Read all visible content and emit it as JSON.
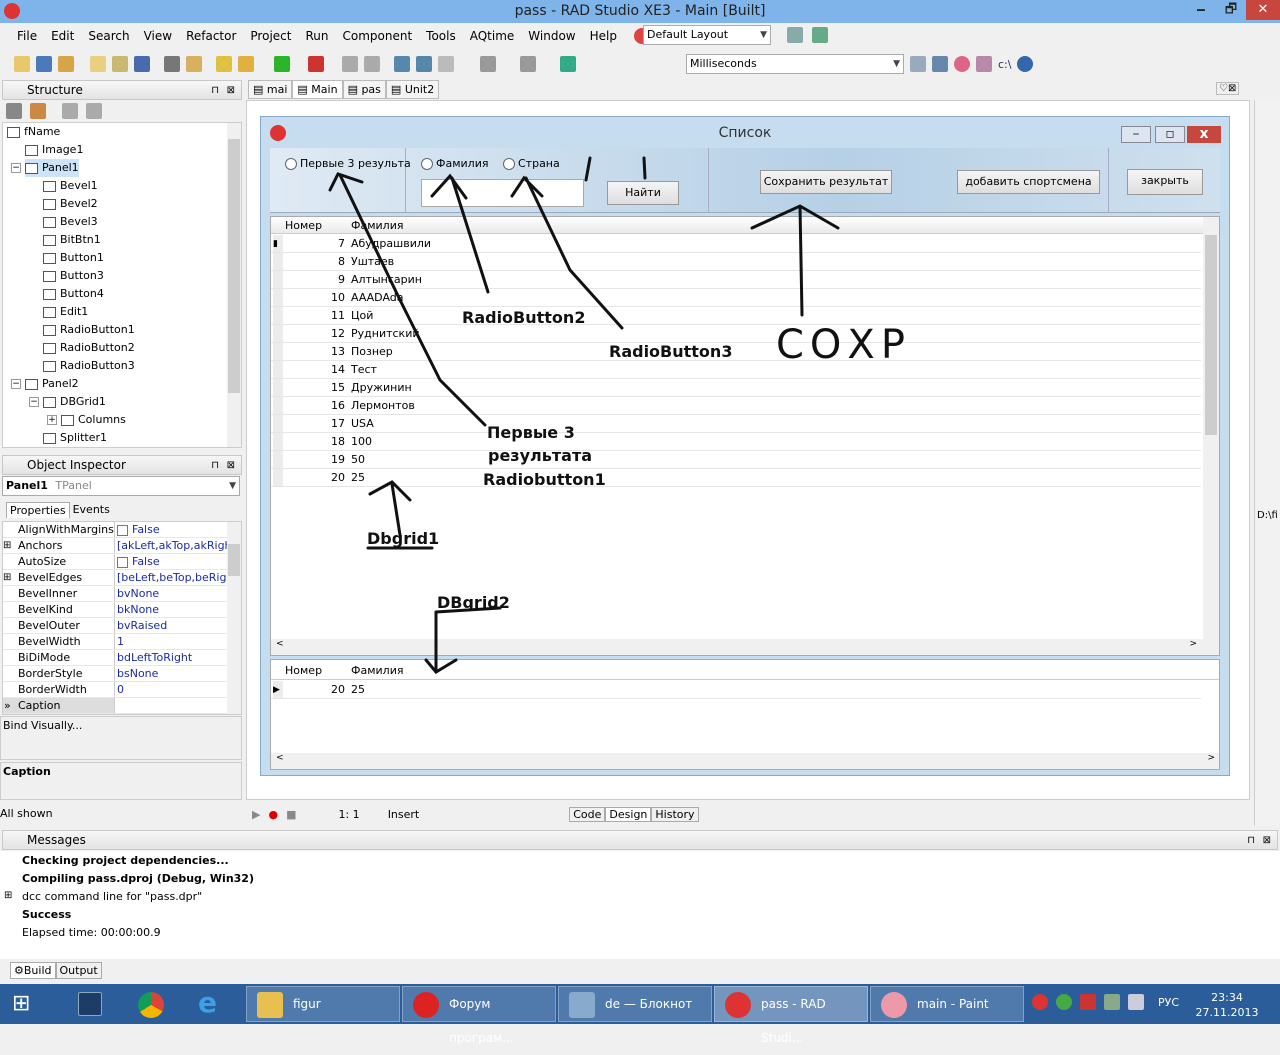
{
  "window": {
    "title": "pass - RAD Studio XE3 - Main [Built]",
    "minimize": "🗕",
    "maximize": "🗗",
    "close": "✕"
  },
  "menu": [
    "File",
    "Edit",
    "Search",
    "View",
    "Refactor",
    "Project",
    "Run",
    "Component",
    "Tools",
    "AQtime",
    "Window",
    "Help"
  ],
  "toolbar": {
    "layout_combo": "Default Layout",
    "profiler_combo": "Milliseconds",
    "path_button": "c:\\"
  },
  "structure": {
    "title": "Structure",
    "tree": [
      {
        "label": "fName",
        "level": 0,
        "expander": "−"
      },
      {
        "label": "Image1",
        "level": 1
      },
      {
        "label": "Panel1",
        "level": 1,
        "expander": "−",
        "selected": true
      },
      {
        "label": "Bevel1",
        "level": 2
      },
      {
        "label": "Bevel2",
        "level": 2
      },
      {
        "label": "Bevel3",
        "level": 2
      },
      {
        "label": "BitBtn1",
        "level": 2
      },
      {
        "label": "Button1",
        "level": 2
      },
      {
        "label": "Button3",
        "level": 2
      },
      {
        "label": "Button4",
        "level": 2
      },
      {
        "label": "Edit1",
        "level": 2
      },
      {
        "label": "RadioButton1",
        "level": 2
      },
      {
        "label": "RadioButton2",
        "level": 2
      },
      {
        "label": "RadioButton3",
        "level": 2
      },
      {
        "label": "Panel2",
        "level": 1,
        "expander": "−"
      },
      {
        "label": "DBGrid1",
        "level": 2,
        "expander": "−"
      },
      {
        "label": "Columns",
        "level": 3,
        "expander": "+"
      },
      {
        "label": "Splitter1",
        "level": 2
      }
    ]
  },
  "inspector": {
    "title": "Object Inspector",
    "object_name": "Panel1",
    "object_type": "TPanel",
    "tabs": [
      "Properties",
      "Events"
    ],
    "properties": [
      {
        "key": "AlignWithMargins",
        "value": "False",
        "checkbox": true
      },
      {
        "key": "Anchors",
        "value": "[akLeft,akTop,akRight]",
        "expander": "+"
      },
      {
        "key": "AutoSize",
        "value": "False",
        "checkbox": true
      },
      {
        "key": "BevelEdges",
        "value": "[beLeft,beTop,beRight",
        "expander": "+"
      },
      {
        "key": "BevelInner",
        "value": "bvNone"
      },
      {
        "key": "BevelKind",
        "value": "bkNone"
      },
      {
        "key": "BevelOuter",
        "value": "bvRaised"
      },
      {
        "key": "BevelWidth",
        "value": "1"
      },
      {
        "key": "BiDiMode",
        "value": "bdLeftToRight"
      },
      {
        "key": "BorderStyle",
        "value": "bsNone"
      },
      {
        "key": "BorderWidth",
        "value": "0"
      },
      {
        "key": "Caption",
        "value": "",
        "selected": true
      }
    ],
    "bind_visually": "Bind Visually...",
    "help_title": "Caption",
    "status": "All shown"
  },
  "editor": {
    "tabs": [
      "mai",
      "Main",
      "pas",
      "Unit2"
    ],
    "active_tab": "Main",
    "status": {
      "position": "1:   1",
      "mode": "Insert"
    },
    "bottom_tabs": [
      "Code",
      "Design",
      "History"
    ],
    "active_bottom_tab": "Design"
  },
  "form": {
    "title": "Список",
    "radio1": "Первые 3 результа",
    "radio2": "Фамилия",
    "radio3": "Страна",
    "edit_value": "",
    "find_button": "Найти",
    "save_button": "Сохранить результат",
    "add_button": "добавить спортсмена",
    "close_button": "закрыть",
    "grid1": {
      "columns": [
        "Номер",
        "Фамилия"
      ],
      "rows": [
        {
          "num": "7",
          "name": "Абудрашвили"
        },
        {
          "num": "8",
          "name": "Уштаев"
        },
        {
          "num": "9",
          "name": "Алтынсарин"
        },
        {
          "num": "10",
          "name": "AAADAda"
        },
        {
          "num": "11",
          "name": "Цой"
        },
        {
          "num": "12",
          "name": "Руднитский"
        },
        {
          "num": "13",
          "name": "Познер"
        },
        {
          "num": "14",
          "name": "Тест"
        },
        {
          "num": "15",
          "name": "Дружинин"
        },
        {
          "num": "16",
          "name": "Лермонтов"
        },
        {
          "num": "17",
          "name": "USA"
        },
        {
          "num": "18",
          "name": "100"
        },
        {
          "num": "19",
          "name": "50"
        },
        {
          "num": "20",
          "name": "25"
        }
      ]
    },
    "grid2": {
      "columns": [
        "Номер",
        "Фамилия"
      ],
      "rows": [
        {
          "num": "20",
          "name": "25"
        }
      ]
    }
  },
  "annotations": {
    "rb2": "RadioButton2",
    "rb3": "RadioButton3",
    "save": "СОХР",
    "rb1_line1": "Первые 3",
    "rb1_line2": "результата",
    "rb1_line3": "Radiobutton1",
    "dbgrid1": "Dbgrid1",
    "dbgrid2": "DBgrid2"
  },
  "messages": {
    "title": "Messages",
    "lines": [
      {
        "text": "Checking project dependencies...",
        "bold": true
      },
      {
        "text": "Compiling pass.dproj (Debug, Win32)",
        "bold": true
      },
      {
        "text": "dcc command line for \"pass.dpr\"",
        "bold": false,
        "expander": "+"
      },
      {
        "text": "Success",
        "bold": true
      },
      {
        "text": "Elapsed time: 00:00:00.9",
        "bold": false
      }
    ],
    "tabs": [
      "Build",
      "Output"
    ]
  },
  "right_strip": {
    "path": "D:\\fi"
  },
  "taskbar": {
    "items": [
      {
        "label": "figur",
        "icon": "folder-icon"
      },
      {
        "label": "Форум програм...",
        "icon": "opera-icon"
      },
      {
        "label": "de — Блокнот",
        "icon": "notepad-icon"
      },
      {
        "label": "pass - RAD Studi...",
        "icon": "rad-studio-icon",
        "active": true
      },
      {
        "label": "main - Paint",
        "icon": "paint-icon"
      }
    ],
    "language": "РУС",
    "time": "23:34",
    "date": "27.11.2013"
  },
  "colors": {
    "titlebar": "#7fb4ea",
    "taskbar": "#2a5d9a",
    "selection": "#cde3f8",
    "annotation": "#111111"
  }
}
